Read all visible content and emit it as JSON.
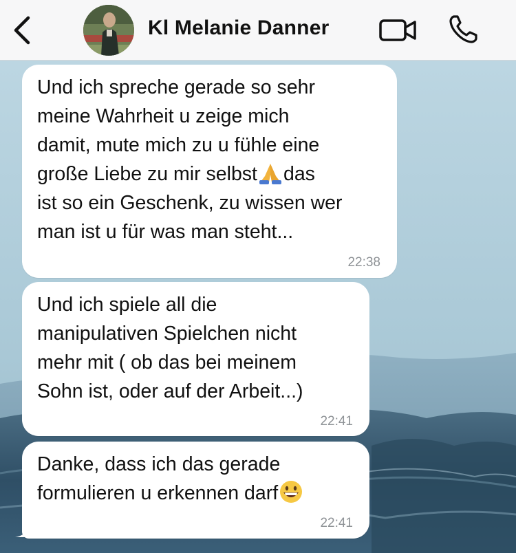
{
  "header": {
    "back_icon": "chevron-left-icon",
    "contact_name": "Kl Melanie Danner",
    "video_icon": "video-camera-icon",
    "call_icon": "phone-icon"
  },
  "messages": [
    {
      "text_before": "Und ich spreche gerade so sehr\nmeine Wahrheit u zeige mich\ndamit, mute mich zu u fühle eine\ngroße Liebe zu mir selbst",
      "emoji": "folded-hands-emoji",
      "text_after": "das\nist so ein Geschenk, zu wissen wer\nman ist u für was man steht...",
      "time": "22:38"
    },
    {
      "text": "Und ich spiele all die\nmanipulativen Spielchen nicht\nmehr mit ( ob das bei meinem\nSohn ist, oder auf der Arbeit...)",
      "time": "22:41"
    },
    {
      "text_before": "Danke, dass ich das gerade\nformulieren u erkennen darf",
      "emoji": "grinning-face-emoji",
      "time": "22:41"
    }
  ],
  "colors": {
    "header_bg": "#f7f7f8",
    "bubble_bg": "#ffffff",
    "time_text": "#8e9296",
    "wallpaper_sky": "#bcd5e1",
    "wallpaper_sea": "#2f4f66"
  }
}
